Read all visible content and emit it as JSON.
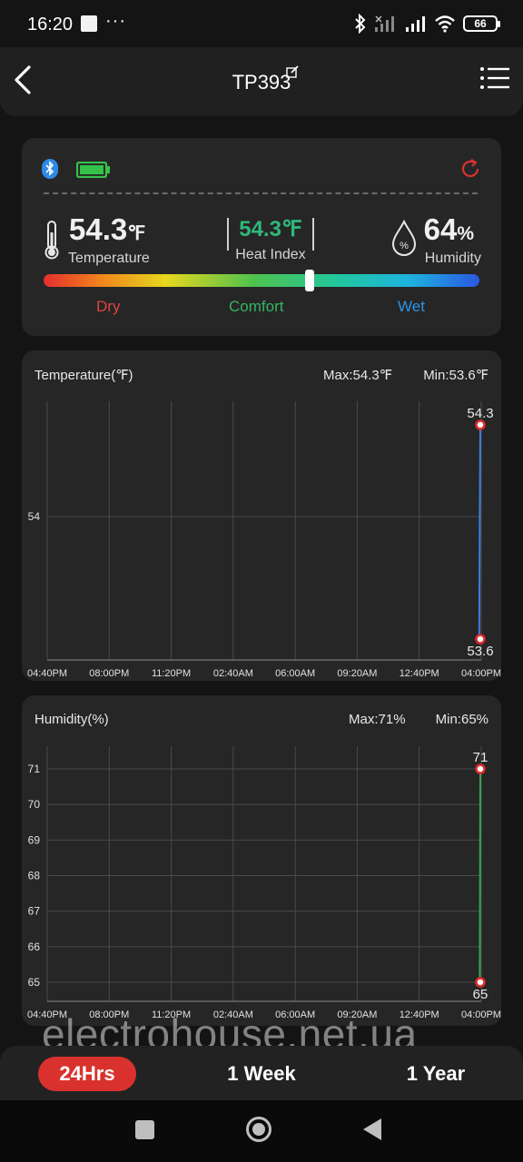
{
  "status_bar": {
    "time": "16:20",
    "more": "···",
    "battery_level": "66",
    "icons": [
      "bluetooth-icon",
      "signal-icon",
      "signal-icon",
      "wifi-icon",
      "battery-icon"
    ]
  },
  "header": {
    "title": "TP393",
    "icons": [
      "back-arrow-icon",
      "edit-icon",
      "menu-list-icon"
    ]
  },
  "summary": {
    "temperature": {
      "value": "54.3",
      "unit": "℉",
      "label": "Temperature"
    },
    "heat_index": {
      "value": "54.3",
      "unit": "℉",
      "label": "Heat Index"
    },
    "humidity": {
      "value": "64",
      "unit": "%",
      "label": "Humidity"
    },
    "comfort_scale": {
      "dry": "Dry",
      "comfort": "Comfort",
      "wet": "Wet",
      "position": 0.61
    },
    "colors": {
      "heat_index": "#2fb879",
      "dry": "#e04343",
      "comfort": "#35b461",
      "wet": "#2d93e6",
      "bluetooth": "#2d8ae6",
      "battery": "#35c24a",
      "refresh": "#d9322e"
    }
  },
  "temperature_chart": {
    "title": "Temperature(℉)",
    "max_label": "Max:54.3℉",
    "min_label": "Min:53.6℉"
  },
  "humidity_chart": {
    "title": "Humidity(%)",
    "max_label": "Max:71%",
    "min_label": "Min:65%"
  },
  "chart_data": [
    {
      "type": "line",
      "title": "Temperature(℉)",
      "x_ticks": [
        "04:40PM",
        "08:00PM",
        "11:20PM",
        "02:40AM",
        "06:00AM",
        "09:20AM",
        "12:40PM",
        "04:00PM"
      ],
      "y_ticks": [
        "54"
      ],
      "ylim": [
        53.6,
        54.3
      ],
      "series": [
        {
          "values": [
            53.6,
            54.0,
            54.3
          ],
          "color": "#3a7ee0"
        }
      ],
      "point_labels": [
        "54.3",
        "53.6"
      ],
      "grid": true
    },
    {
      "type": "line",
      "title": "Humidity(%)",
      "x_ticks": [
        "04:40PM",
        "08:00PM",
        "11:20PM",
        "02:40AM",
        "06:00AM",
        "09:20AM",
        "12:40PM",
        "04:00PM"
      ],
      "y_ticks": [
        "71",
        "70",
        "69",
        "68",
        "67",
        "66",
        "65"
      ],
      "ylim": [
        65,
        71
      ],
      "series": [
        {
          "values": [
            65,
            71
          ],
          "color": "#2fa84f"
        }
      ],
      "point_labels": [
        "71",
        "65"
      ],
      "grid": true
    }
  ],
  "watermark": "electrohouse.net.ua",
  "tabs": [
    "24Hrs",
    "1 Week",
    "1 Year"
  ],
  "nav_bar": [
    "recents-icon",
    "home-icon",
    "back-icon"
  ]
}
